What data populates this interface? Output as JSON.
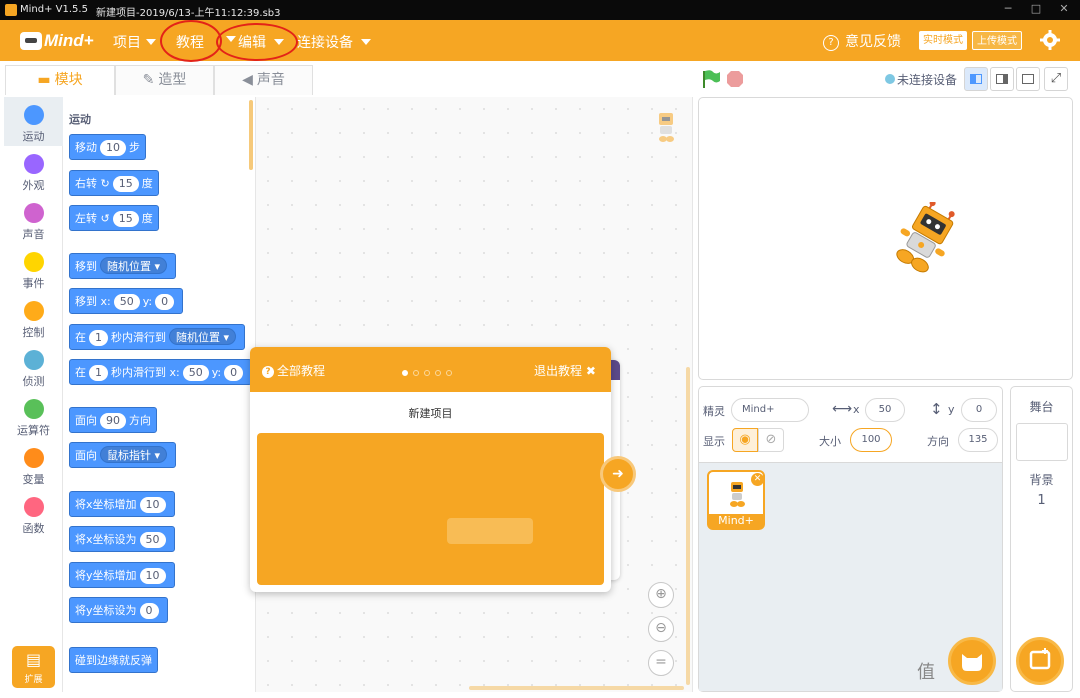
{
  "titlebar": {
    "app_title": "Mind+ V1.5.5",
    "doc_title": "新建项目-2019/6/13-上午11:12:39.sb3",
    "window_buttons": [
      "─",
      "□",
      "✕"
    ]
  },
  "menubar": {
    "logo_text": "Mind+",
    "items": [
      {
        "label": "项目"
      },
      {
        "label": "教程"
      },
      {
        "label": "编辑"
      },
      {
        "label": "连接设备"
      }
    ],
    "feedback_label": "意见反馈",
    "realtime_mode": "实时模式",
    "upload_mode": "上传模式",
    "highlight_color": "#e32318",
    "accent_color": "#f6a623"
  },
  "tabs": [
    {
      "label": "模块"
    },
    {
      "label": "造型"
    },
    {
      "label": "声音"
    }
  ],
  "categories": [
    {
      "label": "运动",
      "color": "#4c97ff"
    },
    {
      "label": "外观",
      "color": "#9966ff"
    },
    {
      "label": "声音",
      "color": "#cf63cf"
    },
    {
      "label": "事件",
      "color": "#ffd500"
    },
    {
      "label": "控制",
      "color": "#ffab19"
    },
    {
      "label": "侦测",
      "color": "#5cb1d6"
    },
    {
      "label": "运算符",
      "color": "#59c059"
    },
    {
      "label": "变量",
      "color": "#ff8c1a"
    },
    {
      "label": "函数",
      "color": "#ff6680"
    }
  ],
  "extension_label": "扩展",
  "palette": {
    "title": "运动",
    "blocks": {
      "move": {
        "a": "移动",
        "v": "10",
        "b": "步"
      },
      "turn_right": {
        "a": "右转",
        "v": "15",
        "b": "度"
      },
      "turn_left": {
        "a": "左转",
        "v": "15",
        "b": "度"
      },
      "goto": {
        "a": "移到",
        "dd": "随机位置"
      },
      "goto_xy": {
        "a": "移到 x:",
        "x": "50",
        "b": "y:",
        "y": "0"
      },
      "glide": {
        "a": "在",
        "v": "1",
        "b": "秒内滑行到",
        "dd": "随机位置"
      },
      "glide_xy": {
        "a": "在",
        "v": "1",
        "b": "秒内滑行到 x:",
        "x": "50",
        "c": "y:",
        "y": "0"
      },
      "point": {
        "a": "面向",
        "v": "90",
        "b": "方向"
      },
      "point_towards": {
        "a": "面向",
        "dd": "鼠标指针"
      },
      "change_x": {
        "a": "将x坐标增加",
        "v": "10"
      },
      "set_x": {
        "a": "将x坐标设为",
        "v": "50"
      },
      "change_y": {
        "a": "将y坐标增加",
        "v": "10"
      },
      "set_y": {
        "a": "将y坐标设为",
        "v": "0"
      },
      "bounce": {
        "a": "碰到边缘就反弹"
      }
    }
  },
  "tutorial": {
    "all_label": "全部教程",
    "exit_label": "退出教程",
    "title": "新建项目",
    "step_count": 5,
    "current_step": 1
  },
  "stage_header": {
    "status": "未连接设备"
  },
  "sprite_info": {
    "sprite_label": "精灵",
    "sprite_name": "Mind+",
    "x_label": "x",
    "x_value": "50",
    "y_label": "y",
    "y_value": "0",
    "show_label": "显示",
    "size_label": "大小",
    "size_value": "100",
    "direction_label": "方向",
    "direction_value": "135",
    "tile_name": "Mind+"
  },
  "stage_pane": {
    "title": "舞台",
    "backdrop_label": "背景",
    "backdrop_count": "1"
  }
}
